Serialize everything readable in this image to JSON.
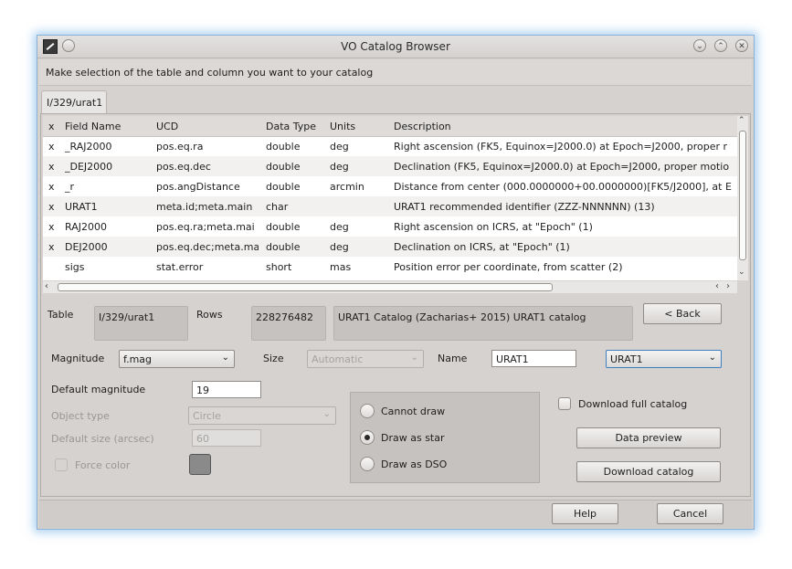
{
  "window": {
    "title": "VO Catalog Browser",
    "instruction": "Make selection of the table and column you want to your catalog",
    "controls": {
      "minimize": "⌄",
      "maximize": "⌃",
      "close": "✕"
    }
  },
  "tabs": [
    {
      "label": "I/329/urat1"
    }
  ],
  "table": {
    "headers": [
      "x",
      "Field Name",
      "UCD",
      "Data Type",
      "Units",
      "Description"
    ],
    "rows": [
      [
        "x",
        "_RAJ2000",
        "pos.eq.ra",
        "double",
        "deg",
        "Right ascension (FK5, Equinox=J2000.0) at Epoch=J2000, proper r"
      ],
      [
        "x",
        "_DEJ2000",
        "pos.eq.dec",
        "double",
        "deg",
        "Declination (FK5, Equinox=J2000.0) at Epoch=J2000, proper motio"
      ],
      [
        "x",
        "_r",
        "pos.angDistance",
        "double",
        "arcmin",
        "Distance from center (000.0000000+00.0000000)[FK5/J2000], at E"
      ],
      [
        "x",
        "URAT1",
        "meta.id;meta.main",
        "char",
        "",
        "URAT1 recommended identifier (ZZZ-NNNNNN) (13)"
      ],
      [
        "x",
        "RAJ2000",
        "pos.eq.ra;meta.mai",
        "double",
        "deg",
        "Right ascension on ICRS, at \"Epoch\" (1)"
      ],
      [
        "x",
        "DEJ2000",
        "pos.eq.dec;meta.ma",
        "double",
        "deg",
        "Declination on ICRS, at \"Epoch\" (1)"
      ],
      [
        "",
        "sigs",
        "stat.error",
        "short",
        "mas",
        "Position error per coordinate, from scatter (2)"
      ]
    ]
  },
  "info": {
    "table_label": "Table",
    "table_value": "I/329/urat1",
    "rows_label": "Rows",
    "rows_value": "228276482",
    "description": "URAT1 Catalog (Zacharias+ 2015) URAT1 catalog",
    "back_button": "< Back"
  },
  "options": {
    "magnitude_label": "Magnitude",
    "magnitude_value": "f.mag",
    "size_label": "Size",
    "size_value": "Automatic",
    "name_label": "Name",
    "name_value": "URAT1",
    "name_select_value": "URAT1",
    "default_magnitude_label": "Default magnitude",
    "default_magnitude_value": "19",
    "object_type_label": "Object type",
    "object_type_value": "Circle",
    "default_size_label": "Default size (arcsec)",
    "default_size_value": "60",
    "force_color_label": "Force color",
    "force_color_swatch": "#8a8a8a"
  },
  "draw_mode": {
    "options": [
      "Cannot draw",
      "Draw as star",
      "Draw as DSO"
    ],
    "selected": "Draw as star"
  },
  "actions": {
    "download_full_label": "Download full catalog",
    "data_preview": "Data preview",
    "download_catalog": "Download catalog",
    "help": "Help",
    "cancel": "Cancel"
  }
}
